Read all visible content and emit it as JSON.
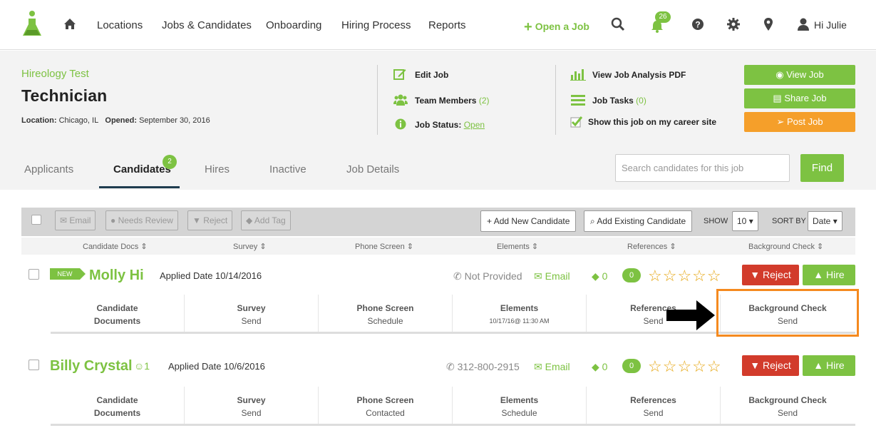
{
  "nav": {
    "links": [
      "Locations",
      "Jobs & Candidates",
      "Onboarding",
      "Hiring Process",
      "Reports"
    ],
    "open_job": "Open a Job",
    "notification_count": "26",
    "greeting": "Hi Julie"
  },
  "job": {
    "company": "Hireology Test",
    "title": "Technician",
    "location_label": "Location:",
    "location": "Chicago, IL",
    "opened_label": "Opened:",
    "opened": "September 30, 2016",
    "edit_job": "Edit Job",
    "team_members": "Team Members",
    "team_members_count": "(2)",
    "job_status": "Job Status:",
    "job_status_value": "Open",
    "view_pdf": "View Job Analysis PDF",
    "job_tasks": "Job Tasks",
    "job_tasks_count": "(0)",
    "career_site": "Show this job on my career site",
    "view_job": "View Job",
    "share_job": "Share Job",
    "post_job": "Post Job"
  },
  "tabs": {
    "applicants": "Applicants",
    "candidates": "Candidates",
    "candidates_badge": "2",
    "hires": "Hires",
    "inactive": "Inactive",
    "job_details": "Job Details"
  },
  "search": {
    "placeholder": "Search candidates for this job",
    "find": "Find"
  },
  "toolbar": {
    "email": "Email",
    "needs_review": "Needs Review",
    "reject": "Reject",
    "add_tag": "Add Tag",
    "add_new": "Add New Candidate",
    "add_existing": "Add Existing Candidate",
    "show_label": "SHOW",
    "show_value": "10",
    "sort_label": "SORT BY",
    "sort_value": "Date"
  },
  "columns": [
    "Candidate Docs",
    "Survey",
    "Phone Screen",
    "Elements",
    "References",
    "Background Check"
  ],
  "candidates": [
    {
      "badge": "NEW",
      "name": "Molly Hi",
      "applied": "Applied Date 10/14/2016",
      "phone": "Not Provided",
      "email": "Email",
      "tags": "0",
      "comments": "0",
      "stars": "☆☆☆☆☆",
      "reject": "Reject",
      "hire": "Hire",
      "steps": [
        {
          "label": "Candidate Documents",
          "value": ""
        },
        {
          "label": "Survey",
          "value": "Send"
        },
        {
          "label": "Phone Screen",
          "value": "Schedule"
        },
        {
          "label": "Elements",
          "value": "10/17/16@ 11:30 AM"
        },
        {
          "label": "References",
          "value": "Send"
        },
        {
          "label": "Background Check",
          "value": "Send"
        }
      ]
    },
    {
      "name": "Billy Crystal",
      "referrals": "1",
      "applied": "Applied Date 10/6/2016",
      "phone": "312-800-2915",
      "email": "Email",
      "tags": "0",
      "comments": "0",
      "stars": "☆☆☆☆☆",
      "reject": "Reject",
      "hire": "Hire",
      "steps": [
        {
          "label": "Candidate Documents",
          "value": ""
        },
        {
          "label": "Survey",
          "value": "Send"
        },
        {
          "label": "Phone Screen",
          "value": "Contacted"
        },
        {
          "label": "Elements",
          "value": "Schedule"
        },
        {
          "label": "References",
          "value": "Send"
        },
        {
          "label": "Background Check",
          "value": "Send"
        }
      ]
    }
  ],
  "colors": {
    "brand_green": "#7dc242",
    "reject_red": "#d23b2b",
    "post_orange": "#f59f2a",
    "highlight_orange": "#f58a1f"
  }
}
